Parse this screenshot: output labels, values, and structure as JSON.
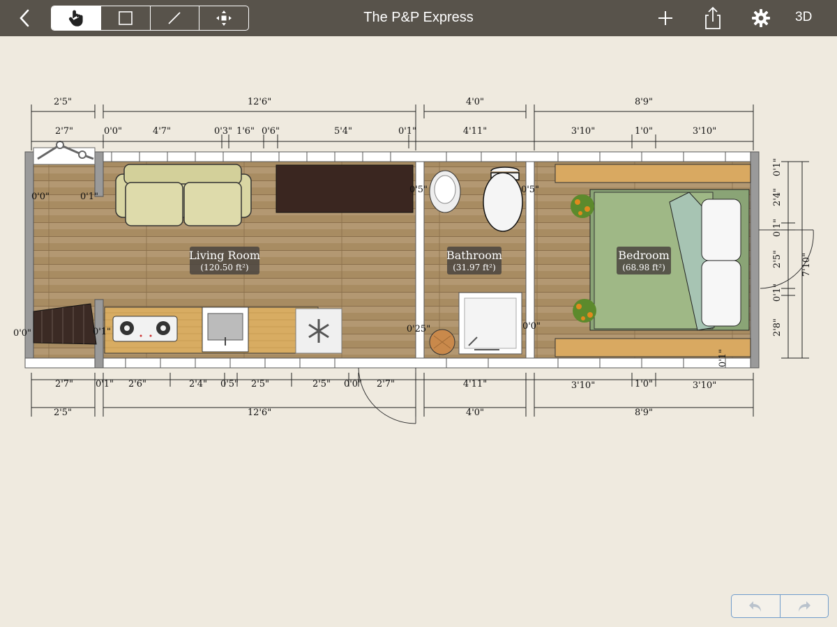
{
  "toolbar": {
    "title": "The P&P Express",
    "label_3d": "3D",
    "tools": [
      "select-hand",
      "rectangle",
      "line",
      "move"
    ],
    "active_tool": "select-hand"
  },
  "rooms": [
    {
      "name": "Living Room",
      "area": "(120.50 ft²)"
    },
    {
      "name": "Bathroom",
      "area": "(31.97 ft²)"
    },
    {
      "name": "Bedroom",
      "area": "(68.98 ft²)"
    }
  ],
  "dims": {
    "top_outer": [
      "2'5\"",
      "12'6\"",
      "4'0\"",
      "8'9\""
    ],
    "top_inner": [
      "2'7\"",
      "0'0\"",
      "4'7\"",
      "0'3\"",
      "1'6\"",
      "0'6\"",
      "5'4\"",
      "0'1\"",
      "4'11\"",
      "3'10\"",
      "1'0\"",
      "3'10\""
    ],
    "bottom_inner": [
      "2'7\"",
      "0'1\"",
      "2'6\"",
      "2'4\"",
      "0'5\"",
      "2'5\"",
      "2'5\"",
      "0'0\"",
      "2'7\"",
      "4'11\"",
      "3'10\"",
      "1'0\"",
      "3'10\""
    ],
    "bottom_outer": [
      "2'5\"",
      "12'6\"",
      "4'0\"",
      "8'9\""
    ],
    "right_inner": [
      "0'1\"",
      "2'4\"",
      "0'1\"",
      "2'5\"",
      "0'1\"",
      "2'8\""
    ],
    "right_outer": [
      "7'10\""
    ],
    "wall_labels": [
      "0'0\"",
      "0'1\"",
      "0'0\"",
      "0'1\"",
      "0'5\"",
      "0'5\"",
      "0'25\"",
      "0'0\"",
      "0'1\""
    ]
  },
  "colors": {
    "toolbar": "#58534b",
    "floor": "#a88c62",
    "sofa": "#d9d6a3",
    "bed": "#9fb886",
    "accent": "#6f9ccb"
  }
}
